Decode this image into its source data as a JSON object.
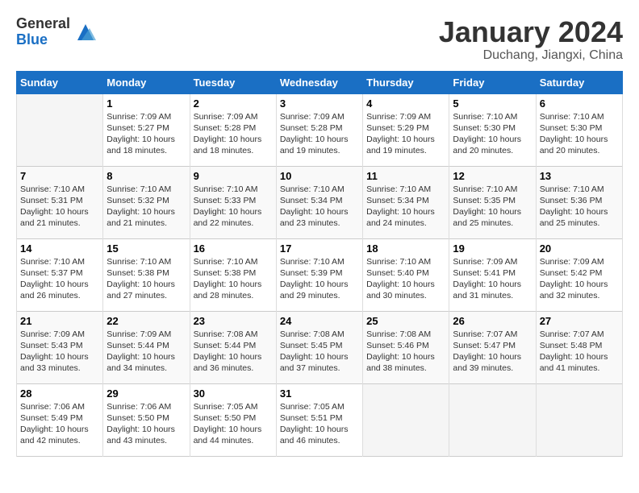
{
  "logo": {
    "general": "General",
    "blue": "Blue"
  },
  "title": {
    "month": "January 2024",
    "location": "Duchang, Jiangxi, China"
  },
  "headers": [
    "Sunday",
    "Monday",
    "Tuesday",
    "Wednesday",
    "Thursday",
    "Friday",
    "Saturday"
  ],
  "weeks": [
    [
      {
        "day": "",
        "info": ""
      },
      {
        "day": "1",
        "info": "Sunrise: 7:09 AM\nSunset: 5:27 PM\nDaylight: 10 hours\nand 18 minutes."
      },
      {
        "day": "2",
        "info": "Sunrise: 7:09 AM\nSunset: 5:28 PM\nDaylight: 10 hours\nand 18 minutes."
      },
      {
        "day": "3",
        "info": "Sunrise: 7:09 AM\nSunset: 5:28 PM\nDaylight: 10 hours\nand 19 minutes."
      },
      {
        "day": "4",
        "info": "Sunrise: 7:09 AM\nSunset: 5:29 PM\nDaylight: 10 hours\nand 19 minutes."
      },
      {
        "day": "5",
        "info": "Sunrise: 7:10 AM\nSunset: 5:30 PM\nDaylight: 10 hours\nand 20 minutes."
      },
      {
        "day": "6",
        "info": "Sunrise: 7:10 AM\nSunset: 5:30 PM\nDaylight: 10 hours\nand 20 minutes."
      }
    ],
    [
      {
        "day": "7",
        "info": "Sunrise: 7:10 AM\nSunset: 5:31 PM\nDaylight: 10 hours\nand 21 minutes."
      },
      {
        "day": "8",
        "info": "Sunrise: 7:10 AM\nSunset: 5:32 PM\nDaylight: 10 hours\nand 21 minutes."
      },
      {
        "day": "9",
        "info": "Sunrise: 7:10 AM\nSunset: 5:33 PM\nDaylight: 10 hours\nand 22 minutes."
      },
      {
        "day": "10",
        "info": "Sunrise: 7:10 AM\nSunset: 5:34 PM\nDaylight: 10 hours\nand 23 minutes."
      },
      {
        "day": "11",
        "info": "Sunrise: 7:10 AM\nSunset: 5:34 PM\nDaylight: 10 hours\nand 24 minutes."
      },
      {
        "day": "12",
        "info": "Sunrise: 7:10 AM\nSunset: 5:35 PM\nDaylight: 10 hours\nand 25 minutes."
      },
      {
        "day": "13",
        "info": "Sunrise: 7:10 AM\nSunset: 5:36 PM\nDaylight: 10 hours\nand 25 minutes."
      }
    ],
    [
      {
        "day": "14",
        "info": "Sunrise: 7:10 AM\nSunset: 5:37 PM\nDaylight: 10 hours\nand 26 minutes."
      },
      {
        "day": "15",
        "info": "Sunrise: 7:10 AM\nSunset: 5:38 PM\nDaylight: 10 hours\nand 27 minutes."
      },
      {
        "day": "16",
        "info": "Sunrise: 7:10 AM\nSunset: 5:38 PM\nDaylight: 10 hours\nand 28 minutes."
      },
      {
        "day": "17",
        "info": "Sunrise: 7:10 AM\nSunset: 5:39 PM\nDaylight: 10 hours\nand 29 minutes."
      },
      {
        "day": "18",
        "info": "Sunrise: 7:10 AM\nSunset: 5:40 PM\nDaylight: 10 hours\nand 30 minutes."
      },
      {
        "day": "19",
        "info": "Sunrise: 7:09 AM\nSunset: 5:41 PM\nDaylight: 10 hours\nand 31 minutes."
      },
      {
        "day": "20",
        "info": "Sunrise: 7:09 AM\nSunset: 5:42 PM\nDaylight: 10 hours\nand 32 minutes."
      }
    ],
    [
      {
        "day": "21",
        "info": "Sunrise: 7:09 AM\nSunset: 5:43 PM\nDaylight: 10 hours\nand 33 minutes."
      },
      {
        "day": "22",
        "info": "Sunrise: 7:09 AM\nSunset: 5:44 PM\nDaylight: 10 hours\nand 34 minutes."
      },
      {
        "day": "23",
        "info": "Sunrise: 7:08 AM\nSunset: 5:44 PM\nDaylight: 10 hours\nand 36 minutes."
      },
      {
        "day": "24",
        "info": "Sunrise: 7:08 AM\nSunset: 5:45 PM\nDaylight: 10 hours\nand 37 minutes."
      },
      {
        "day": "25",
        "info": "Sunrise: 7:08 AM\nSunset: 5:46 PM\nDaylight: 10 hours\nand 38 minutes."
      },
      {
        "day": "26",
        "info": "Sunrise: 7:07 AM\nSunset: 5:47 PM\nDaylight: 10 hours\nand 39 minutes."
      },
      {
        "day": "27",
        "info": "Sunrise: 7:07 AM\nSunset: 5:48 PM\nDaylight: 10 hours\nand 41 minutes."
      }
    ],
    [
      {
        "day": "28",
        "info": "Sunrise: 7:06 AM\nSunset: 5:49 PM\nDaylight: 10 hours\nand 42 minutes."
      },
      {
        "day": "29",
        "info": "Sunrise: 7:06 AM\nSunset: 5:50 PM\nDaylight: 10 hours\nand 43 minutes."
      },
      {
        "day": "30",
        "info": "Sunrise: 7:05 AM\nSunset: 5:50 PM\nDaylight: 10 hours\nand 44 minutes."
      },
      {
        "day": "31",
        "info": "Sunrise: 7:05 AM\nSunset: 5:51 PM\nDaylight: 10 hours\nand 46 minutes."
      },
      {
        "day": "",
        "info": ""
      },
      {
        "day": "",
        "info": ""
      },
      {
        "day": "",
        "info": ""
      }
    ]
  ]
}
